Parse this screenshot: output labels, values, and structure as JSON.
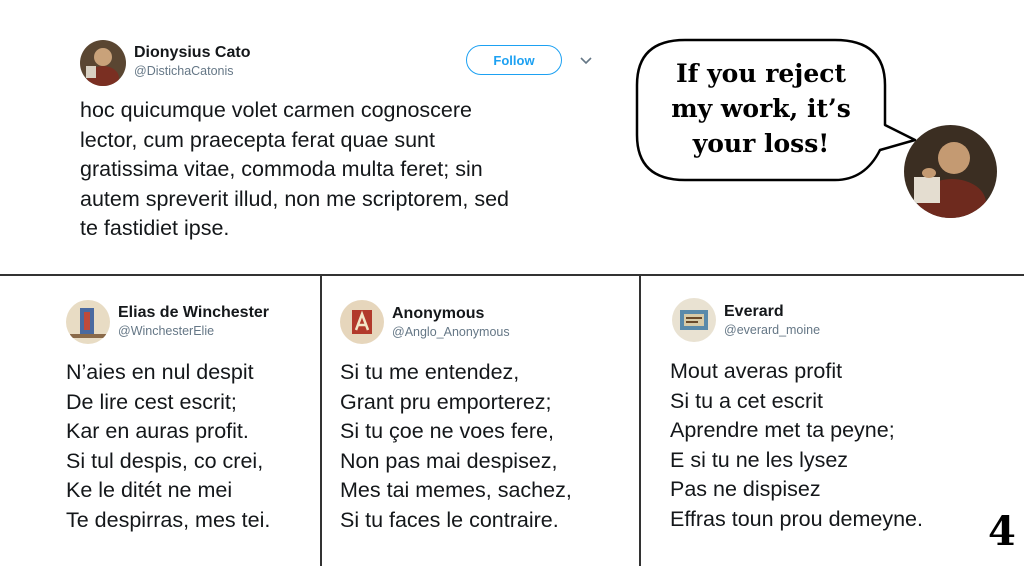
{
  "main_tweet": {
    "name": "Dionysius Cato",
    "handle": "@DistichaCatonis",
    "follow_label": "Follow",
    "lines": [
      "hoc quicumque volet carmen cognoscere",
      "lector, cum praecepta ferat quae sunt",
      "gratissima vitae, commoda multa feret; sin",
      "autem spreverit illud, non me scriptorem, sed",
      "te fastidiet ipse."
    ]
  },
  "speech_bubble": {
    "lines": [
      "If you reject",
      "my work, it’s",
      "your loss!"
    ]
  },
  "tweets": [
    {
      "name": "Elias de Winchester",
      "handle": "@WinchesterElie",
      "lines": [
        "N’aies en nul despit",
        "De lire cest escrit;",
        "Kar en auras profit.",
        "Si tul despis, co crei,",
        "Ke le ditét ne mei",
        "Te despirras, mes tei."
      ]
    },
    {
      "name": "Anonymous",
      "handle": "@Anglo_Anonymous",
      "lines": [
        "Si tu me entendez,",
        "Grant pru emporterez;",
        "Si tu çoe ne voes fere,",
        "Non pas mai despisez,",
        "Mes tai memes, sachez,",
        "Si tu faces le contraire."
      ]
    },
    {
      "name": "Everard",
      "handle": "@everard_moine",
      "lines": [
        "Mout averas profit",
        "Si tu a cet escrit",
        "Aprendre met ta peyne;",
        "E si tu ne les lysez",
        "Pas ne dispisez",
        "Effras toun prou demeyne."
      ]
    }
  ],
  "page_number": "4",
  "colors": {
    "accent": "#1da1f2",
    "handle": "#657786",
    "text": "#14171a"
  }
}
